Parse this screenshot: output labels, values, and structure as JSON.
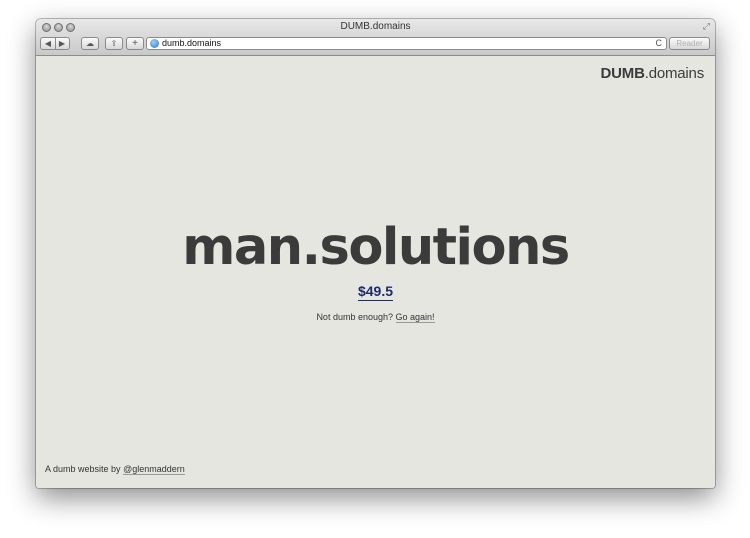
{
  "window": {
    "title": "DUMB.domains"
  },
  "toolbar": {
    "back_glyph": "◀",
    "forward_glyph": "▶",
    "cloud_glyph": "☁",
    "share_glyph": "⇪",
    "add_glyph": "+",
    "url": "dumb.domains",
    "reload_glyph": "C",
    "reader_label": "Reader"
  },
  "page": {
    "brand_bold": "DUMB",
    "brand_rest": ".domains",
    "domain_name": "man.solutions",
    "price": "$49.5",
    "prompt_text": "Not dumb enough?",
    "again_link": "Go again!",
    "footer_text": "A dumb website by",
    "footer_link": "@glenmaddern"
  },
  "colors": {
    "background": "#e6e6e1",
    "price": "#1d2b6b",
    "text": "#3b3b3b"
  }
}
